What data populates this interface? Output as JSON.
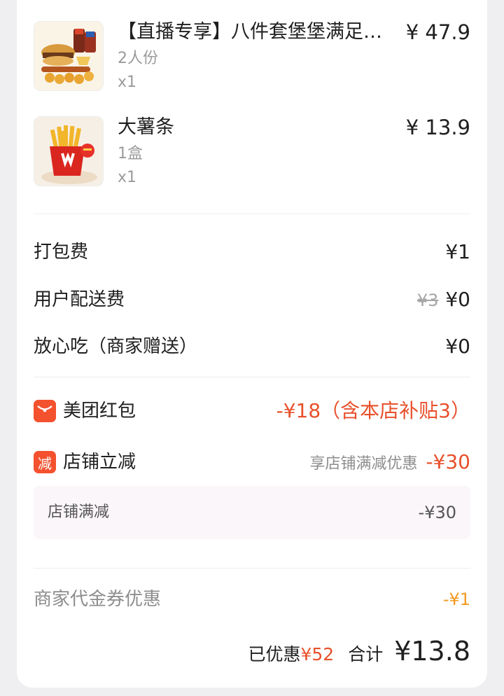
{
  "items": [
    {
      "name": "【直播专享】八件套堡堡满足双…",
      "spec": "2人份",
      "qty": "x1",
      "price": "¥ 47.9",
      "image_icon": "burger-combo-image"
    },
    {
      "name": "大薯条",
      "spec": "1盒",
      "qty": "x1",
      "price": "¥ 13.9",
      "image_icon": "fries-image"
    }
  ],
  "fees": {
    "packing": {
      "label": "打包费",
      "value": "¥1"
    },
    "delivery": {
      "label": "用户配送费",
      "original": "¥3",
      "value": "¥0"
    },
    "assurance": {
      "label": "放心吃（商家赠送）",
      "value": "¥0"
    }
  },
  "discounts": {
    "redpacket": {
      "icon": "red-envelope-icon",
      "label": "美团红包",
      "value": "-¥18（含本店补贴3）"
    },
    "store_cut": {
      "badge": "减",
      "label": "店铺立减",
      "note": "享店铺满减优惠",
      "value": "-¥30",
      "sub_label": "店铺满减",
      "sub_value": "-¥30"
    },
    "voucher": {
      "label": "商家代金券优惠",
      "value": "-¥1"
    }
  },
  "summary": {
    "saved_label": "已优惠",
    "saved_value": "¥52",
    "total_label": "合计",
    "total_value": "¥13.8"
  },
  "colors": {
    "accent_red": "#e8502b",
    "accent_orange": "#f39a22",
    "background": "#efeff1"
  }
}
